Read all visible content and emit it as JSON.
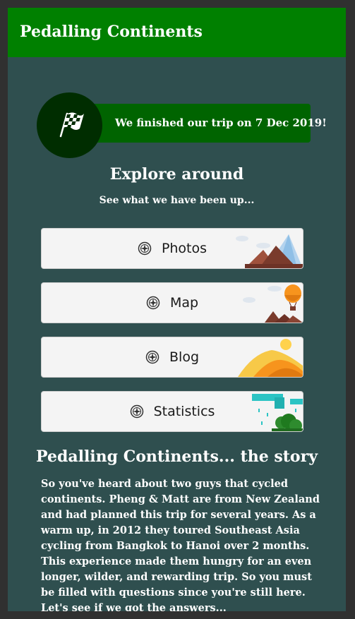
{
  "app": {
    "title": "Pedalling Continents"
  },
  "finish_banner": {
    "text": "We finished our trip on 7 Dec 2019!",
    "icon": "checkered-flag-icon"
  },
  "explore": {
    "title": "Explore around",
    "subtitle": "See what we have been up...",
    "buttons": [
      {
        "label": "Photos",
        "icon": "compass-icon"
      },
      {
        "label": "Map",
        "icon": "compass-icon"
      },
      {
        "label": "Blog",
        "icon": "compass-icon"
      },
      {
        "label": "Statistics",
        "icon": "compass-icon"
      }
    ]
  },
  "story": {
    "title": "Pedalling Continents... the story",
    "body": "So you've heard about two guys that cycled continents. Pheng & Matt are from New Zealand and had planned this trip for several years. As a warm up, in 2012 they toured Southeast Asia cycling from Bangkok to Hanoi over 2 months. This experience made them hungry for an even longer, wilder, and rewarding trip. So you must be filled with questions since you're still here. Let's see if we got the answers..."
  },
  "colors": {
    "header": "#008000",
    "background": "#2f4f4f",
    "banner": "#006400",
    "banner_circle": "#002d00",
    "button": "#f4f4f4"
  }
}
